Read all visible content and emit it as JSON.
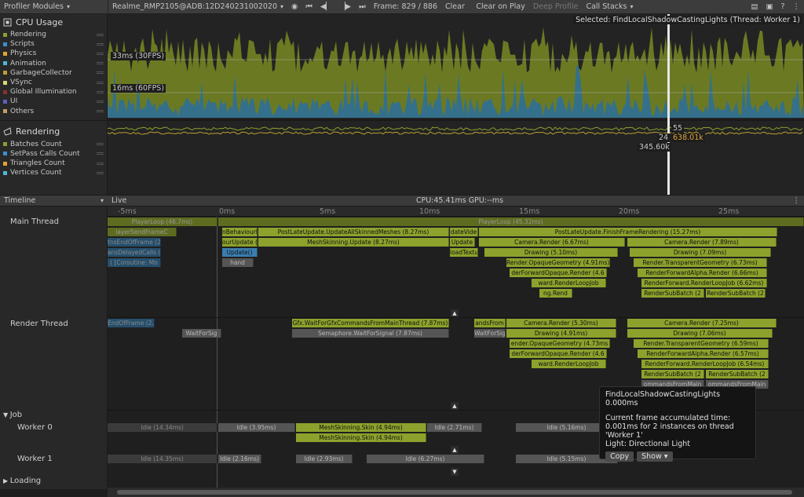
{
  "toolbar": {
    "modules_label": "Profiler Modules",
    "target": "Realme_RMP2105@ADB:12D240231002020",
    "frame_label": "Frame: 829 / 886",
    "clear": "Clear",
    "clear_on_play": "Clear on Play",
    "deep_profile": "Deep Profile",
    "call_stacks": "Call Stacks"
  },
  "cpu_module": {
    "title": "CPU Usage",
    "legend": [
      {
        "label": "Rendering",
        "color": "#8ba030"
      },
      {
        "label": "Scripts",
        "color": "#3d8fd0"
      },
      {
        "label": "Physics",
        "color": "#e0a53a"
      },
      {
        "label": "Animation",
        "color": "#4bb8d8"
      },
      {
        "label": "GarbageCollector",
        "color": "#b8a030"
      },
      {
        "label": "VSync",
        "color": "#d8d870"
      },
      {
        "label": "Global Illumination",
        "color": "#8a3030"
      },
      {
        "label": "UI",
        "color": "#6060c0"
      },
      {
        "label": "Others",
        "color": "#c0a060"
      }
    ],
    "line_30": "33ms (30FPS)",
    "line_60": "16ms (60FPS)",
    "selected": "Selected: FindLocalShadowCastingLights (Thread: Worker 1)"
  },
  "render_module": {
    "title": "Rendering",
    "legend": [
      {
        "label": "Batches Count",
        "color": "#8ba030"
      },
      {
        "label": "SetPass Calls Count",
        "color": "#3d8fd0"
      },
      {
        "label": "Triangles Count",
        "color": "#e0a53a"
      },
      {
        "label": "Vertices Count",
        "color": "#4bb8d8"
      }
    ],
    "val_55": "55",
    "val_24": "24",
    "val_638k": "638.01k",
    "val_345k": "345.60k"
  },
  "timeline": {
    "view": "Timeline",
    "live": "Live",
    "cpu_gpu": "CPU:45.41ms   GPU:--ms",
    "ticks": [
      "-5ms",
      "0ms",
      "5ms",
      "10ms",
      "15ms",
      "20ms",
      "25ms"
    ],
    "threads": {
      "main": "Main Thread",
      "render": "Render Thread",
      "job": "Job",
      "worker0": "Worker 0",
      "worker1": "Worker 1",
      "loading": "Loading"
    }
  },
  "main_bars": {
    "playerloop_prev": "PlayerLoop (46.7ms)",
    "playerloop": "PlayerLoop (45.32ms)",
    "behaviour": "nBehaviourl",
    "postlate_skinned": "PostLateUpdate.UpdateAllSkinnedMeshes (8.27ms)",
    "update_video": "dateVide",
    "postlate_finish": "PostLateUpdate.FinishFrameRendering (15.27ms)",
    "our_update": "ourUpdate (",
    "mesh_skinning": "MeshSkinning.Update (8.27ms)",
    "update_short": "Update",
    "camera_render_1": "Camera.Render (6.67ms)",
    "camera_render_2": "Camera.Render (7.89ms)",
    "update_paren": "Update()",
    "load_textu": "loadTextu",
    "drawing_1": "Drawing (5.10ms)",
    "drawing_2": "Drawing (7.09ms)",
    "opaque_1": "Render.OpaqueGeometry (4.91ms)",
    "transparent_1": "Render.TransparentGeometry (6.73ms)",
    "fwd_opaque_1": "derForwardOpaque.Render (4.6",
    "fwd_alpha_1": "RenderForwardAlpha.Render (6.66ms)",
    "loopjob_1": "ward.RenderLoopJob",
    "loopjob_2": "RenderForward.RenderLoopJob (6.62ms)",
    "ng_render": "ng.Rend",
    "subbatch_1": "RenderSubBatch (2",
    "subbatch_2": "RenderSubBatch (2",
    "player_send": "layerSendFrameC",
    "end_of_frame": "tnsEndOfFrame (2.2",
    "delayed_calls": "ansDelayedCalls (",
    "coroutine": "( [Coroutine: Mo",
    "hand": "hand"
  },
  "render_bars": {
    "end_of_frame": "EndOfFrame (2.",
    "wait_for_signal_l": "WaitForSig",
    "gfx_wait": "Gfx.WaitForGfxCommandsFromMainThread (7.87ms)",
    "semaphore": "Semaphore.WaitForSignal (7.87ms)",
    "ands_from": "andsFrom",
    "wait_for_signal": "WaitForSig",
    "camera_render_1": "Camera.Render (5.30ms)",
    "camera_render_2": "Camera.Render (7.25ms)",
    "drawing_1": "Drawing (4.91ms)",
    "drawing_2": "Drawing (7.06ms)",
    "opaque": "ender.OpaqueGeometry (4.73ms",
    "transparent": "Render.TransparentGeometry (6.59ms)",
    "fwd_opaque": "derForwardOpaque.Render (4.6",
    "fwd_alpha": "RenderForwardAlpha.Render (6.57ms)",
    "loopjob_1": "ward.RenderLoopJob",
    "loopjob_2": "RenderForward.RenderLoopJob (6.54ms)",
    "subbatch_1": "RenderSubBatch (2",
    "subbatch_2": "RenderSubBatch (2",
    "commands_1": "ommandsFromMain",
    "commands_2": "ommandsFromMain"
  },
  "worker0_bars": {
    "idle_1": "Idle (14.34ms)",
    "idle_2": "Idle (3.95ms)",
    "skin_1": "MeshSkinning.Skin (4.94ms)",
    "skin_2": "MeshSkinning.Skin (4.94ms)",
    "idle_3": "Idle (2.71ms)",
    "idle_4": "Idle (5.16ms)"
  },
  "worker1_bars": {
    "idle_1": "Idle (14.35ms)",
    "idle_2": "Idle (2.16ms)",
    "idle_3": "Idle (2.93ms)",
    "idle_4": "Idle (6.27ms)",
    "idle_5": "Idle (5.15ms)"
  },
  "tooltip": {
    "name": "FindLocalShadowCastingLights",
    "time": "0.000ms",
    "accum_label": "Current frame accumulated time:",
    "accum_value": "0.001ms for 2 instances on thread 'Worker 1'",
    "light": "Light: Directional Light",
    "copy": "Copy",
    "show": "Show"
  }
}
